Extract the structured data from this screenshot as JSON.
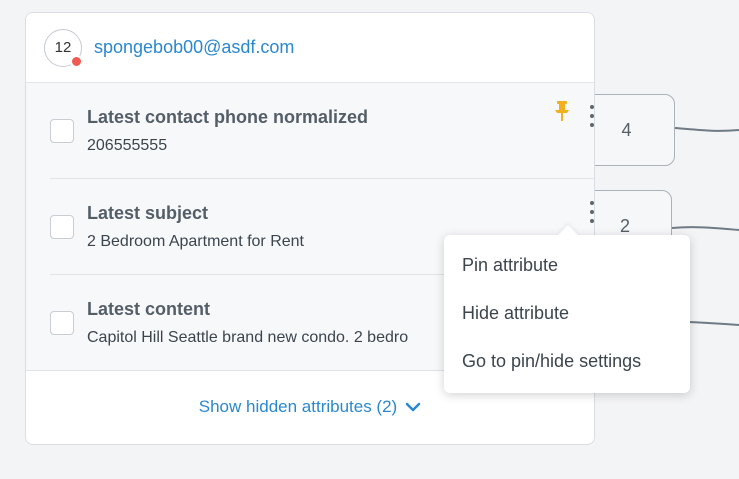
{
  "side_counts": [
    "4",
    "2"
  ],
  "contact": {
    "avatar_count": "12",
    "email": "spongebob00@asdf.com"
  },
  "attributes": [
    {
      "title": "Latest contact phone normalized",
      "value": "206555555",
      "pinned": true
    },
    {
      "title": "Latest subject",
      "value": "2 Bedroom Apartment for Rent",
      "pinned": false
    },
    {
      "title": "Latest content",
      "value": "Capitol Hill Seattle brand new condo. 2 bedro",
      "pinned": false
    }
  ],
  "footer": {
    "show_hidden_label": "Show hidden attributes (2)"
  },
  "menu": {
    "items": [
      "Pin attribute",
      "Hide attribute",
      "Go to pin/hide settings"
    ]
  },
  "colors": {
    "accent": "#2a88d0",
    "pin": "#f2b01e",
    "status_dot": "#ef5a52"
  }
}
